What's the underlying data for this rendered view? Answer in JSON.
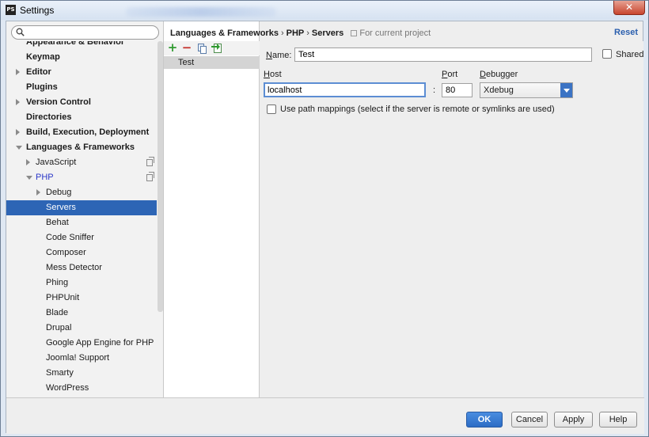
{
  "window": {
    "title": "Settings",
    "app_icon": "phpstorm-app-icon",
    "close_glyph": "✕"
  },
  "search": {
    "placeholder": "",
    "value": ""
  },
  "tree": {
    "items": [
      {
        "label": "Appearance & Behavior",
        "bold": true,
        "indent": 0,
        "arrow": "none",
        "partial": true
      },
      {
        "label": "Keymap",
        "bold": true,
        "indent": 0,
        "arrow": "none"
      },
      {
        "label": "Editor",
        "bold": true,
        "indent": 0,
        "arrow": "right"
      },
      {
        "label": "Plugins",
        "bold": true,
        "indent": 0,
        "arrow": "none"
      },
      {
        "label": "Version Control",
        "bold": true,
        "indent": 0,
        "arrow": "right"
      },
      {
        "label": "Directories",
        "bold": true,
        "indent": 0,
        "arrow": "none"
      },
      {
        "label": "Build, Execution, Deployment",
        "bold": true,
        "indent": 0,
        "arrow": "right"
      },
      {
        "label": "Languages & Frameworks",
        "bold": true,
        "indent": 0,
        "arrow": "down"
      },
      {
        "label": "JavaScript",
        "bold": false,
        "indent": 1,
        "arrow": "right",
        "copy_icon": true
      },
      {
        "label": "PHP",
        "bold": false,
        "indent": 1,
        "arrow": "down",
        "copy_icon": true,
        "link": true
      },
      {
        "label": "Debug",
        "bold": false,
        "indent": 2,
        "arrow": "right"
      },
      {
        "label": "Servers",
        "bold": false,
        "indent": 2,
        "arrow": "none",
        "selected": true
      },
      {
        "label": "Behat",
        "bold": false,
        "indent": 2,
        "arrow": "none"
      },
      {
        "label": "Code Sniffer",
        "bold": false,
        "indent": 2,
        "arrow": "none"
      },
      {
        "label": "Composer",
        "bold": false,
        "indent": 2,
        "arrow": "none"
      },
      {
        "label": "Mess Detector",
        "bold": false,
        "indent": 2,
        "arrow": "none"
      },
      {
        "label": "Phing",
        "bold": false,
        "indent": 2,
        "arrow": "none"
      },
      {
        "label": "PHPUnit",
        "bold": false,
        "indent": 2,
        "arrow": "none"
      },
      {
        "label": "Blade",
        "bold": false,
        "indent": 2,
        "arrow": "none"
      },
      {
        "label": "Drupal",
        "bold": false,
        "indent": 2,
        "arrow": "none"
      },
      {
        "label": "Google App Engine for PHP",
        "bold": false,
        "indent": 2,
        "arrow": "none"
      },
      {
        "label": "Joomla! Support",
        "bold": false,
        "indent": 2,
        "arrow": "none"
      },
      {
        "label": "Smarty",
        "bold": false,
        "indent": 2,
        "arrow": "none"
      },
      {
        "label": "WordPress",
        "bold": false,
        "indent": 2,
        "arrow": "none"
      }
    ]
  },
  "breadcrumb": {
    "items": [
      "Languages & Frameworks",
      "PHP",
      "Servers"
    ],
    "separator": "›",
    "scope": "For current project"
  },
  "reset_label": "Reset",
  "servers_toolbar": {
    "add": "+",
    "remove": "−",
    "copy_icon": "copy-icon",
    "import_icon": "import-icon"
  },
  "servers_list": [
    "Test"
  ],
  "form": {
    "name_label": "Name:",
    "name_mnemonic": "N",
    "name_rest": "ame:",
    "name_value": "Test",
    "shared_label": "Shared",
    "shared_checked": false,
    "host_label": "Host",
    "host_mnemonic": "H",
    "host_rest": "ost",
    "host_value": "localhost",
    "colon": ":",
    "port_label": "Port",
    "port_mnemonic": "P",
    "port_rest": "ort",
    "port_value": "80",
    "debugger_label": "Debugger",
    "debugger_mnemonic": "D",
    "debugger_rest": "ebugger",
    "debugger_value": "Xdebug",
    "path_mappings_label": "Use path mappings (select if the server is remote or symlinks are used)",
    "path_mappings_checked": false
  },
  "buttons": {
    "ok": "OK",
    "cancel": "Cancel",
    "apply": "Apply",
    "help": "Help"
  },
  "colors": {
    "selection": "#2d65b5",
    "primary_button": "#2c6cc5",
    "add": "#2f9a2f",
    "remove": "#c5302a",
    "link": "#2b5fae"
  }
}
